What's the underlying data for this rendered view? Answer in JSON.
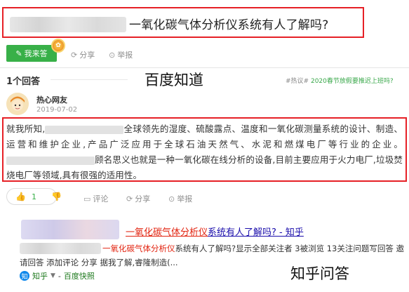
{
  "question": {
    "title": "一氧化碳气体分析仪系统有人了解吗?"
  },
  "actions": {
    "answer_label": "我来答",
    "share_label": "分享",
    "report_label": "举报"
  },
  "answers": {
    "count_label": "1个回答",
    "hot_tag_hash": "#热议#",
    "hot_tag_text": "2020春节放假要推迟上班吗?"
  },
  "labels": {
    "baidu_zhidao": "百度知道",
    "zhihu_qa": "知乎问答"
  },
  "answer": {
    "user_name": "热心网友",
    "date": "2019-07-02",
    "p1": "就我所知,",
    "p2": "全球领先的湿度、硫酸露点、温度和一氧化碳测量系统的设计、制造、运营和维护企业,产品广泛应用于全球石油天然气、水泥和燃煤电厂等行业的企业。",
    "p3": "顾名思义也就是一种一氧化碳在线分析的设备,目前主要应用于火力电厂,垃圾焚烧电厂等领域,具有很强的适用性。"
  },
  "votes": {
    "like_count": "1",
    "comment_label": "评论",
    "share_label": "分享",
    "report_label": "举报"
  },
  "zhihu_result": {
    "title_red": "一氧化碳气体分析仪",
    "title_blue": "系统有人了解吗? - 知乎",
    "snippet_red": "一氧化碳气体分析仪",
    "snippet_text": "系统有人了解吗?显示全部关注者 3被浏览 13关注问题写回答 邀请回答 添加评论 分享 据我了解,睿隆制造(...",
    "source_name": "知乎",
    "source_suffix": "百度快照"
  },
  "colors": {
    "highlight_border": "#e62026",
    "accent_green": "#38b048",
    "link_red": "#e2230f",
    "link_blue": "#1a0dab"
  }
}
